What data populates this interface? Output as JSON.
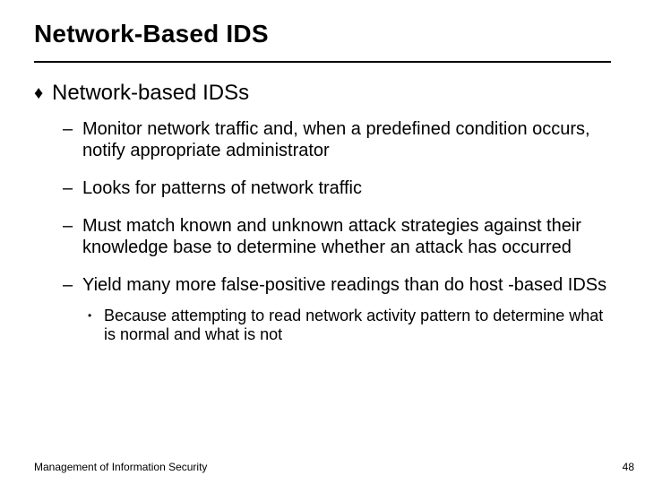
{
  "title": "Network-Based IDS",
  "bullets": {
    "l1": {
      "marker": "♦",
      "text": "Network-based IDSs"
    },
    "l2_1": {
      "marker": "–",
      "text": "Monitor network traffic and, when a predefined condition occurs, notify appropriate administrator"
    },
    "l2_2": {
      "marker": "–",
      "text": "Looks for patterns of network traffic"
    },
    "l2_3": {
      "marker": "–",
      "text": "Must match known and unknown attack strategies against their knowledge base to determine whether an attack has occurred"
    },
    "l2_4": {
      "marker": "–",
      "text": "Yield many more false-positive readings than do host -based IDSs"
    },
    "l3_1": {
      "marker": "•",
      "text": "Because attempting to read network activity pattern to determine what is normal and what is not"
    }
  },
  "footer": {
    "left": "Management of Information Security",
    "right": "48"
  }
}
